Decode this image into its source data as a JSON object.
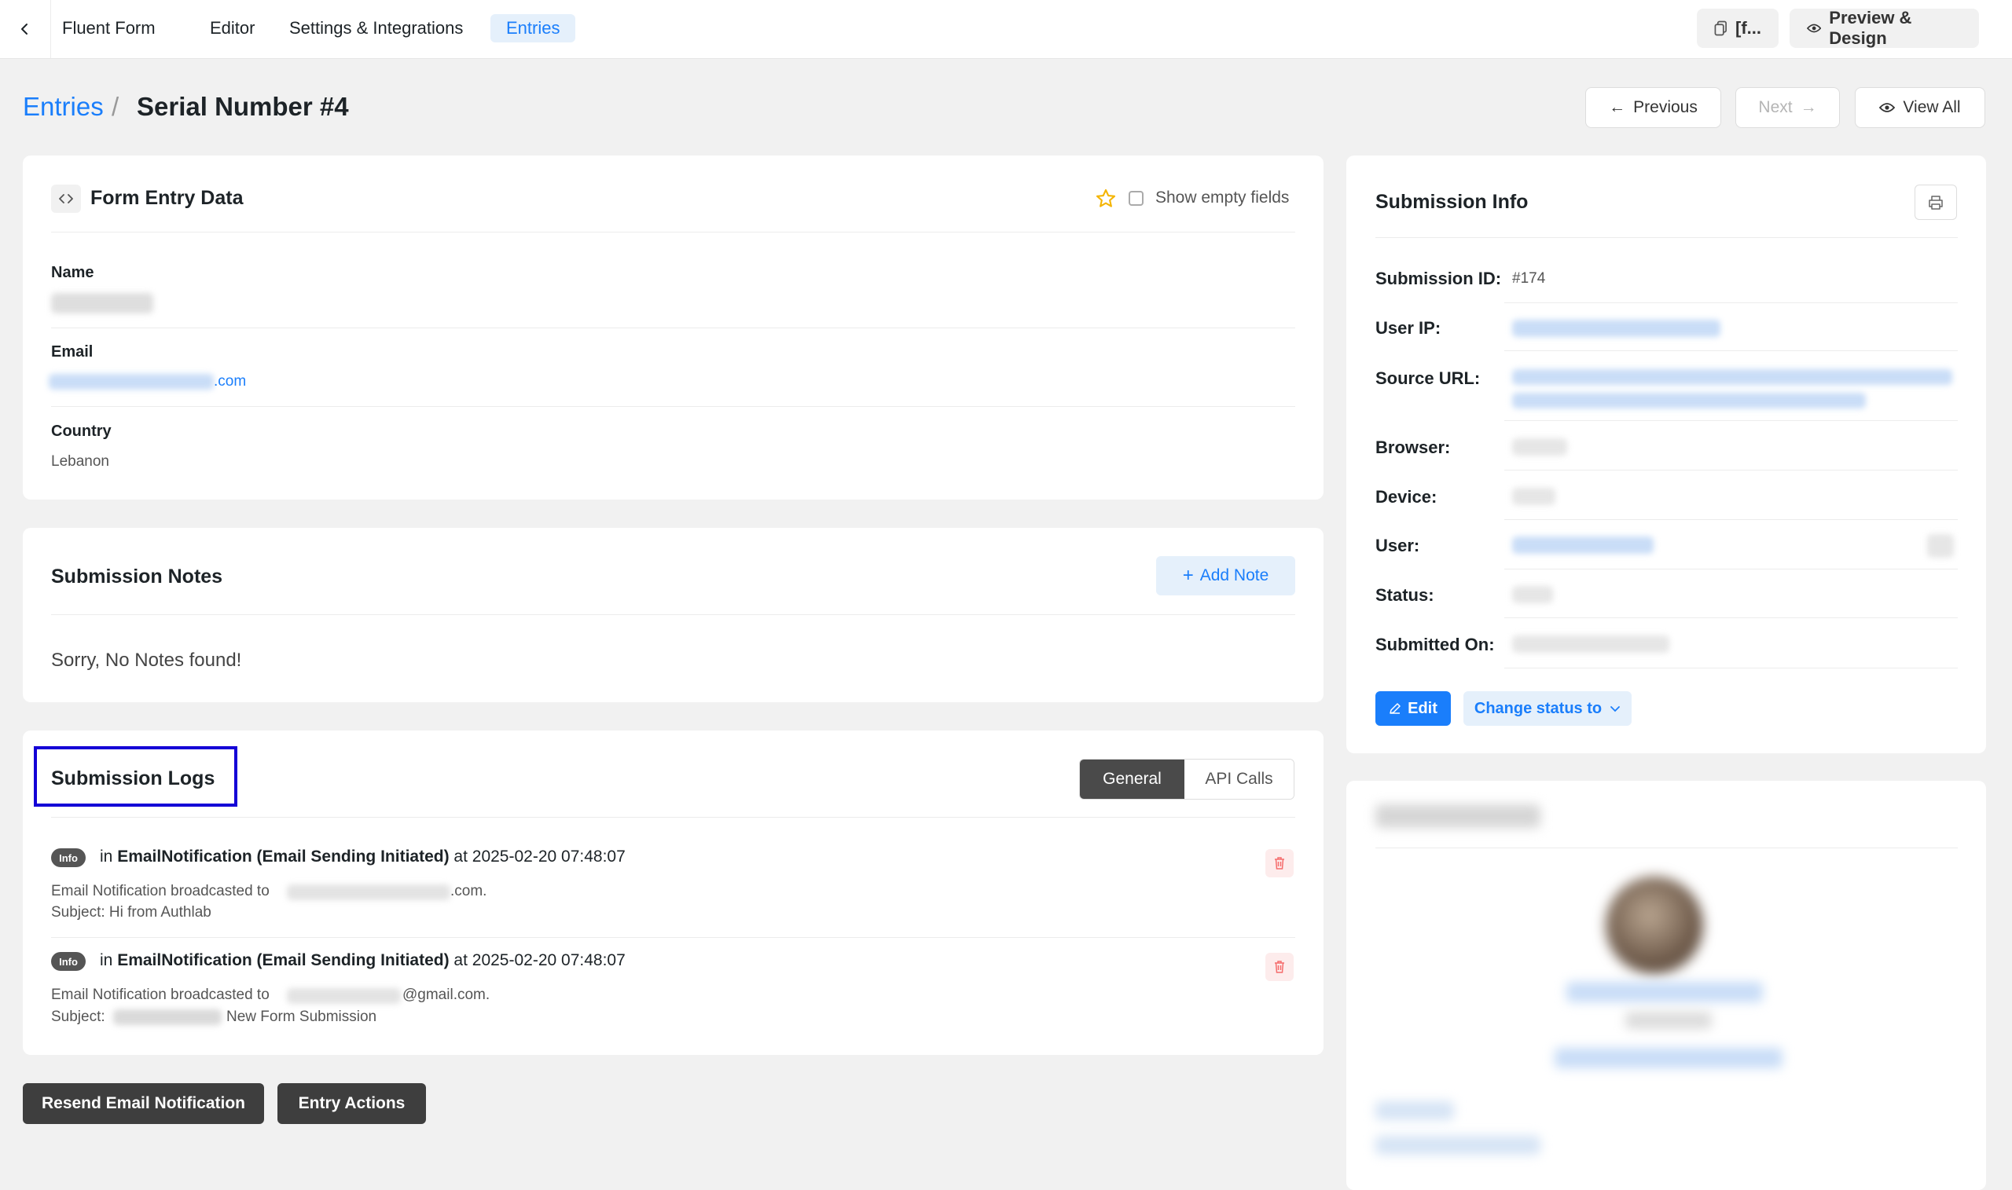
{
  "topbar": {
    "app_title": "Fluent Form",
    "tabs": [
      {
        "label": "Editor"
      },
      {
        "label": "Settings & Integrations"
      },
      {
        "label": "Entries"
      }
    ],
    "shortcode_label": "[f...",
    "preview_label": "Preview & Design"
  },
  "breadcrumb": {
    "parent": "Entries",
    "separator": "/",
    "current": "Serial Number #4"
  },
  "header_nav": {
    "previous": "Previous",
    "next": "Next",
    "view_all": "View All"
  },
  "entry_data": {
    "title": "Form Entry Data",
    "show_empty_label": "Show empty fields",
    "fields": [
      {
        "label": "Name",
        "value": ""
      },
      {
        "label": "Email",
        "value": ".com"
      },
      {
        "label": "Country",
        "value": "Lebanon"
      }
    ]
  },
  "notes": {
    "title": "Submission Notes",
    "add_note_label": "Add Note",
    "empty_text": "Sorry, No Notes found!"
  },
  "logs": {
    "title": "Submission Logs",
    "tabs": [
      {
        "label": "General"
      },
      {
        "label": "API Calls"
      }
    ],
    "entries": [
      {
        "badge": "Info",
        "prefix": "in",
        "source": "EmailNotification (Email Sending Initiated)",
        "at": "at 2025-02-20 07:48:07",
        "line1_prefix": "Email Notification broadcasted to",
        "line1_suffix": ".com.",
        "line2": "Subject: Hi from Authlab"
      },
      {
        "badge": "Info",
        "prefix": "in",
        "source": "EmailNotification (Email Sending Initiated)",
        "at": "at 2025-02-20 07:48:07",
        "line1_prefix": "Email Notification broadcasted to",
        "line1_suffix": "@gmail.com.",
        "line2_prefix": "Subject:",
        "line2_suffix": "New Form Submission"
      }
    ]
  },
  "actions": {
    "resend_label": "Resend Email Notification",
    "entry_actions_label": "Entry Actions"
  },
  "submission_info": {
    "title": "Submission Info",
    "rows": [
      {
        "label": "Submission ID:",
        "value": "#174"
      },
      {
        "label": "User IP:"
      },
      {
        "label": "Source URL:"
      },
      {
        "label": "Browser:"
      },
      {
        "label": "Device:"
      },
      {
        "label": "User:"
      },
      {
        "label": "Status:"
      },
      {
        "label": "Submitted On:"
      }
    ],
    "edit_label": "Edit",
    "change_status_label": "Change status to"
  },
  "colors": {
    "accent": "#1a7efb",
    "highlight_box": "#1400d6",
    "dark_button": "#3e3e3e"
  }
}
